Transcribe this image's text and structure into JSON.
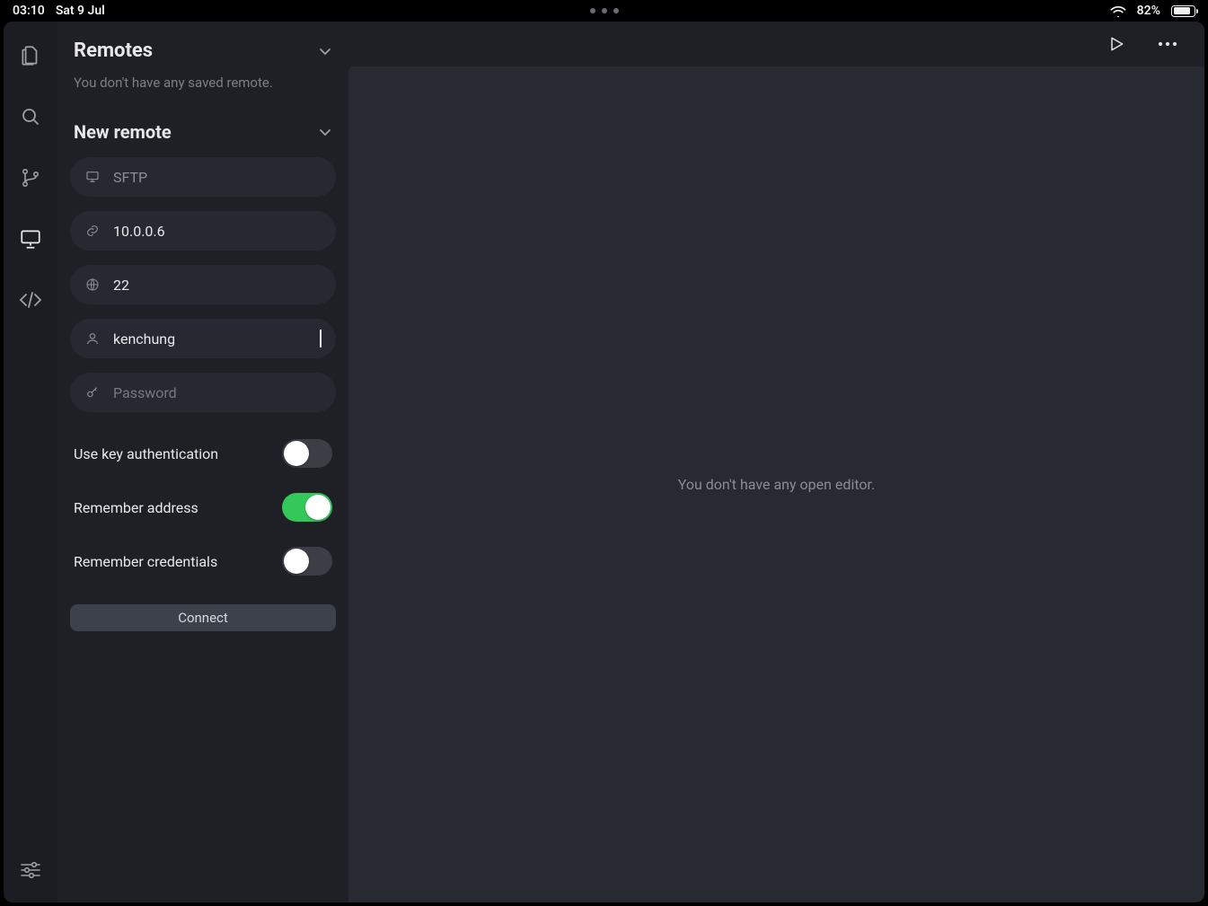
{
  "status_bar": {
    "time": "03:10",
    "date": "Sat 9 Jul",
    "battery_pct_label": "82%",
    "battery_fill_pct": 82
  },
  "activity_bar": {
    "items": [
      {
        "name": "files-icon",
        "active": false
      },
      {
        "name": "search-icon",
        "active": false
      },
      {
        "name": "branch-icon",
        "active": false
      },
      {
        "name": "remote-icon",
        "active": true
      },
      {
        "name": "code-icon",
        "active": false
      }
    ],
    "bottom": {
      "name": "settings-sliders-icon"
    }
  },
  "sidebar": {
    "remotes_title": "Remotes",
    "remotes_hint": "You don't have any saved remote.",
    "new_remote_title": "New remote",
    "fields": {
      "protocol_value": "SFTP",
      "host_value": "10.0.0.6",
      "port_value": "22",
      "username_value": "kenchung",
      "password_value": "",
      "password_placeholder": "Password"
    },
    "toggles": {
      "key_auth_label": "Use key authentication",
      "key_auth_on": false,
      "remember_addr_label": "Remember address",
      "remember_addr_on": true,
      "remember_creds_label": "Remember credentials",
      "remember_creds_on": false
    },
    "connect_label": "Connect"
  },
  "editor": {
    "empty_message": "You don't have any open editor."
  }
}
